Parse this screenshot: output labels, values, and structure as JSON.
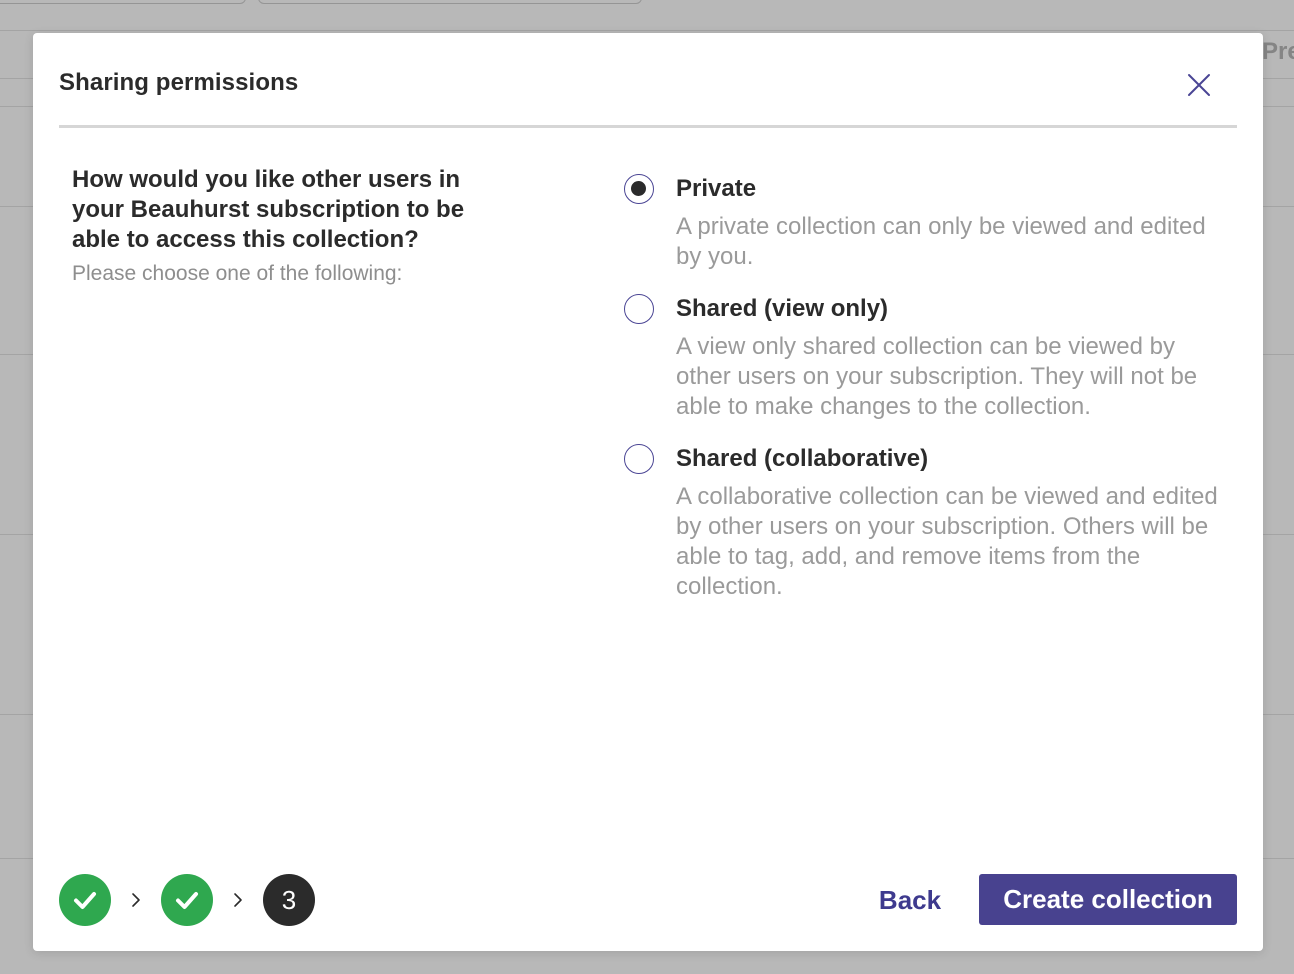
{
  "background": {
    "partial_text": "Pre"
  },
  "modal": {
    "title": "Sharing permissions",
    "close_icon": "close-icon"
  },
  "question": {
    "text": "How would you like other users in your Beauhurst subscription to be able to access this collection?",
    "hint": "Please choose one of the following:"
  },
  "options": [
    {
      "label": "Private",
      "description": "A private collection can only be viewed and edited by you.",
      "selected": true
    },
    {
      "label": "Shared (view only)",
      "description": "A view only shared collection can be viewed by other users on your subscription. They will not be able to make changes to the collection.",
      "selected": false
    },
    {
      "label": "Shared (collaborative)",
      "description": "A collaborative collection can be viewed and edited by other users on your subscription. Others will be able to tag, add, and remove items from the collection.",
      "selected": false
    }
  ],
  "stepper": {
    "steps": [
      {
        "state": "done",
        "icon": "checkmark-icon"
      },
      {
        "state": "done",
        "icon": "checkmark-icon"
      },
      {
        "state": "current",
        "label": "3"
      }
    ],
    "separator_icon": "chevron-right-icon"
  },
  "footer": {
    "back_label": "Back",
    "create_label": "Create collection"
  },
  "colors": {
    "accent": "#48428f",
    "success": "#2fa84f",
    "text": "#2b2b2b",
    "muted": "#9a9a9a"
  }
}
